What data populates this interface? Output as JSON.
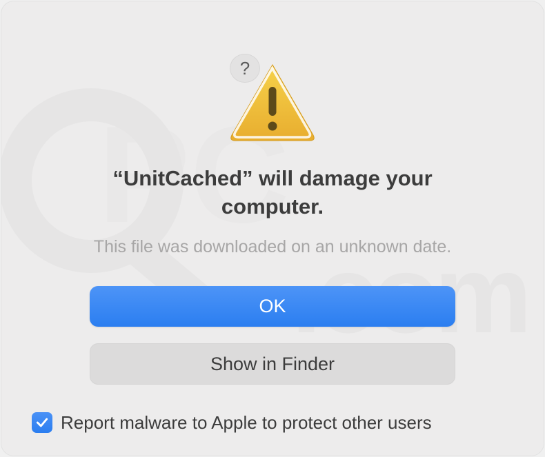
{
  "dialog": {
    "title": "“UnitCached” will damage your computer.",
    "subtitle": "This file was downloaded on an unknown date.",
    "primary_button": "OK",
    "secondary_button": "Show in Finder",
    "checkbox_label": "Report malware to Apple to protect other users",
    "checkbox_checked": true,
    "help_label": "?"
  },
  "icons": {
    "warning": "warning-triangle",
    "help": "question-mark",
    "check": "checkmark"
  }
}
